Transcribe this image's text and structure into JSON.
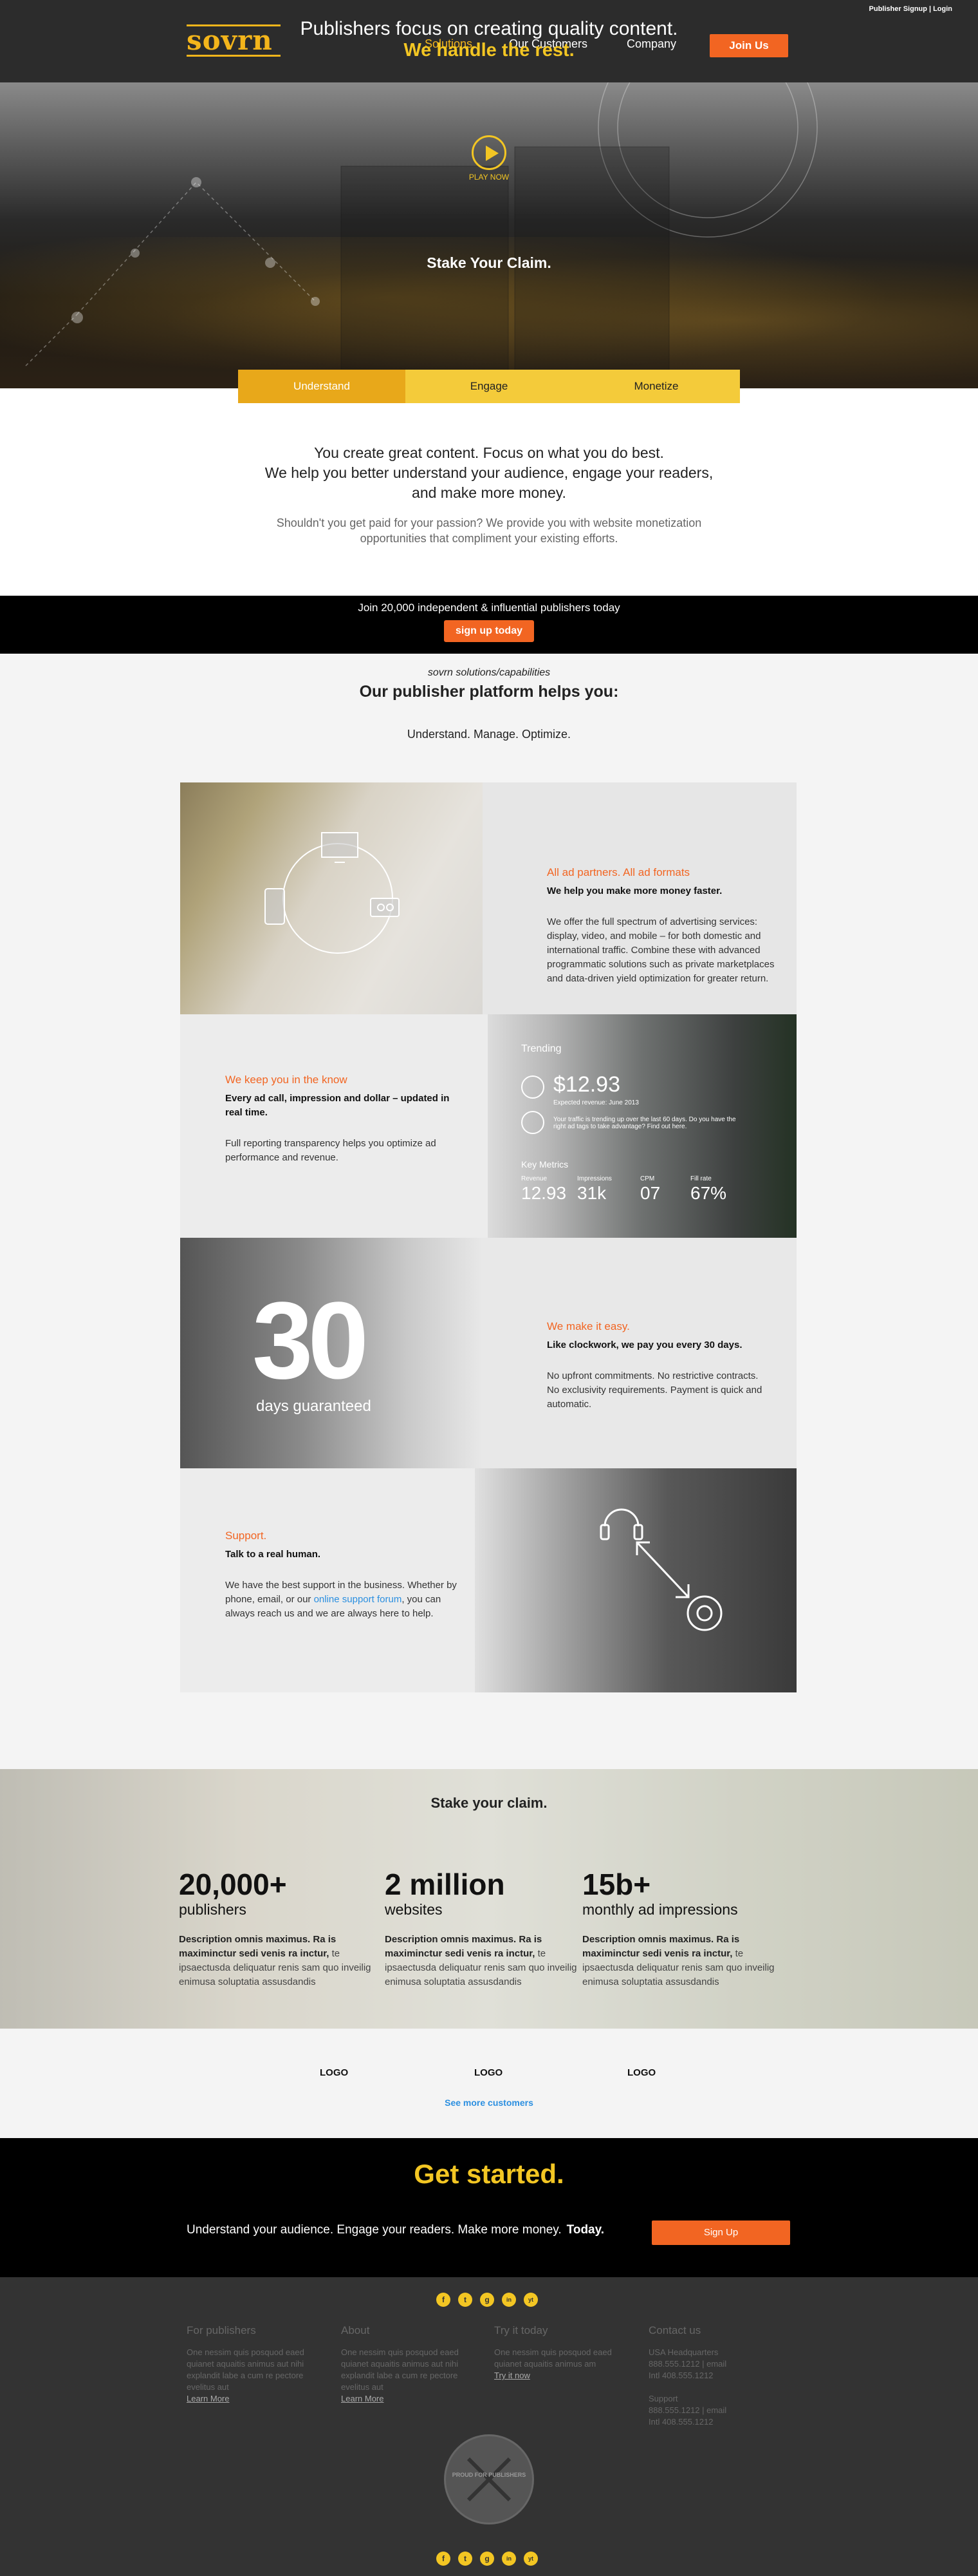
{
  "header": {
    "util_links": [
      "Publisher Signup",
      "Login"
    ],
    "logo_text": "sovrn",
    "nav": [
      "Solutions",
      "Our Customers",
      "Company"
    ],
    "join_label": "Join Us"
  },
  "hero": {
    "line1": "Publishers focus on creating quality content.",
    "line2": "We handle the rest.",
    "play_label": "PLAY NOW",
    "stake": "Stake Your Claim."
  },
  "tabs": [
    "Understand",
    "Engage",
    "Monetize"
  ],
  "intro": {
    "headline_lines": [
      "You create great content. Focus on what you do best.",
      "We help you better understand your audience, engage your readers,",
      "and make more money."
    ],
    "sub_lines": [
      "Shouldn't you get paid for your passion? We provide you with website monetization",
      "opportunities that compliment your existing efforts."
    ]
  },
  "join_banner": {
    "text": "Join  20,000 independent & influential publishers today",
    "button": "sign up today"
  },
  "platform": {
    "kicker": "sovrn solutions/capabilities",
    "title": "Our publisher platform helps you:",
    "tagline": "Understand. Manage. Optimize."
  },
  "features": [
    {
      "heading": "All ad partners. All ad formats",
      "sub": "We help you make more money faster.",
      "desc_lines": [
        "We offer the full spectrum of advertising services:",
        "display, video, and mobile – for both domestic and",
        "international traffic. Combine these with advanced",
        "programmatic solutions such as private marketplaces",
        "and data-driven yield optimization for greater return."
      ]
    },
    {
      "heading": "We keep you in the know",
      "sub_lines": [
        "Every ad call, impression and dollar – updated in",
        "real time."
      ],
      "desc_lines": [
        "Full reporting transparency helps you optimize ad",
        "performance and revenue."
      ],
      "dashboard": {
        "title": "Trending",
        "amount": "$12.93",
        "caption": "Expected revenue: June 2013",
        "note_lines": [
          "Your traffic is trending up over the last 60 days. Do you have the",
          "right ad tags to take advantage? Find out here."
        ],
        "metrics_title": "Key Metrics",
        "metrics": [
          {
            "label": "Revenue",
            "value": "12.93"
          },
          {
            "label": "Impressions",
            "value": "31k"
          },
          {
            "label": "CPM",
            "value": "07"
          },
          {
            "label": "Fill rate",
            "value": "67%"
          }
        ]
      }
    },
    {
      "big_number": "30",
      "big_caption": "days guaranteed",
      "heading": "We make it easy.",
      "sub": "Like clockwork, we pay you every 30 days.",
      "desc_lines": [
        "No upfront commitments. No restrictive contracts.",
        "No exclusivity requirements. Payment is quick and",
        "automatic."
      ]
    },
    {
      "heading": "Support.",
      "sub": "Talk to a real human.",
      "desc_line1": "We have the best support in the business. Whether by",
      "desc_line2a": "phone, email, or our ",
      "desc_link": "online support forum",
      "desc_line2b": ", you can",
      "desc_line3": "always reach us and we are always here to help."
    }
  ],
  "stats": {
    "title": "Stake your claim.",
    "items": [
      {
        "num": "20,000+",
        "label": "publishers",
        "desc_bold": "Description omnis maximus. Ra is maximinctur sedi venis ra inctur,",
        "desc_rest": " te ipsaectusda deliquatur renis sam quo inveilig enimusa soluptatia assusdandis"
      },
      {
        "num": "2 million",
        "label": "websites",
        "desc_bold": "Description omnis maximus. Ra is maximinctur sedi venis ra inctur,",
        "desc_rest": " te ipsaectusda deliquatur renis sam quo inveilig enimusa soluptatia assusdandis"
      },
      {
        "num": "15b+",
        "label": "monthly ad impressions",
        "desc_bold": "Description omnis maximus. Ra is maximinctur sedi venis ra inctur,",
        "desc_rest": " te ipsaectusda deliquatur renis sam quo inveilig enimusa soluptatia assusdandis"
      }
    ]
  },
  "logos": {
    "items": [
      "LOGO",
      "LOGO",
      "LOGO"
    ],
    "see_more": "See more customers"
  },
  "get_started": {
    "title": "Get started.",
    "text": "Understand your audience. Engage your readers. Make more money.",
    "bold": "Today.",
    "button": "Sign Up"
  },
  "footer": {
    "social": [
      "f",
      "t",
      "g",
      "in",
      "yt"
    ],
    "columns": [
      {
        "heading": "For publishers",
        "lines": [
          "One nessim quis posquod eaed",
          "quianet aquaitis animus aut nihi",
          "explandit labe a cum re pectore",
          "evelitus aut"
        ],
        "link": "Learn More"
      },
      {
        "heading": "About",
        "lines": [
          "One nessim quis posquod eaed",
          "quianet aquaitis animus aut nihi",
          "explandit labe a cum re pectore",
          "evelitus aut"
        ],
        "link": "Learn More"
      },
      {
        "heading": "Try it today",
        "lines": [
          "One nessim quis posquod eaed",
          "quianet aquaitis animus am"
        ],
        "link": "Try it now"
      },
      {
        "heading": "Contact us",
        "lines": [
          "USA Headquarters",
          "888.555.1212 | email",
          "Intl 408.555.1212",
          "",
          "Support",
          "888.555.1212 | email",
          "Intl 408.555.1212"
        ],
        "link": ""
      }
    ],
    "seal_text": "PROUD FOR PUBLISHERS"
  },
  "colors": {
    "accent": "#f3c623",
    "orange": "#f26522",
    "dark": "#2c2c2c"
  }
}
